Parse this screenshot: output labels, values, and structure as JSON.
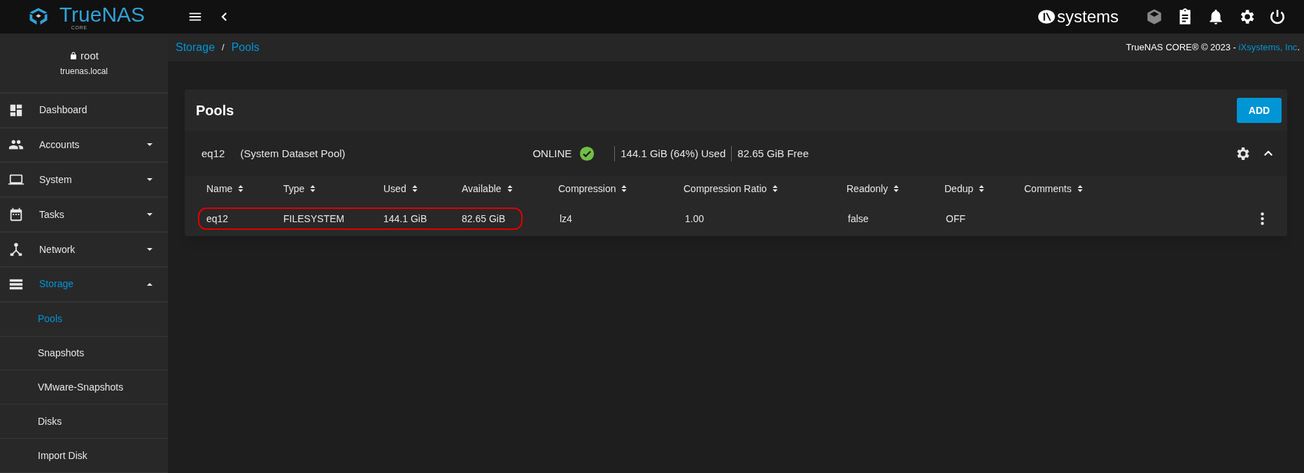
{
  "topbar": {
    "logo_text": "TrueNAS",
    "logo_sub": "CORE",
    "vendor_logo": "systems"
  },
  "user": {
    "name": "root",
    "host": "truenas.local"
  },
  "sidebar": {
    "items": [
      {
        "label": "Dashboard",
        "expandable": false,
        "expanded": false,
        "selected": false
      },
      {
        "label": "Accounts",
        "expandable": true,
        "expanded": false,
        "selected": false
      },
      {
        "label": "System",
        "expandable": true,
        "expanded": false,
        "selected": false
      },
      {
        "label": "Tasks",
        "expandable": true,
        "expanded": false,
        "selected": false
      },
      {
        "label": "Network",
        "expandable": true,
        "expanded": false,
        "selected": false
      },
      {
        "label": "Storage",
        "expandable": true,
        "expanded": true,
        "selected": true,
        "children": [
          {
            "label": "Pools",
            "selected": true
          },
          {
            "label": "Snapshots",
            "selected": false
          },
          {
            "label": "VMware-Snapshots",
            "selected": false
          },
          {
            "label": "Disks",
            "selected": false
          },
          {
            "label": "Import Disk",
            "selected": false
          }
        ]
      }
    ]
  },
  "breadcrumb": {
    "separator": "/",
    "items": [
      "Storage",
      "Pools"
    ]
  },
  "copyright": {
    "text": "TrueNAS CORE® © 2023 - ",
    "link": "iXsystems, Inc",
    "end": "."
  },
  "card": {
    "title": "Pools",
    "add_button": "ADD",
    "pool": {
      "name": "eq12",
      "note": "(System Dataset Pool)",
      "status": "ONLINE",
      "healthy": true,
      "used": "144.1 GiB (64%) Used",
      "free": "82.65 GiB Free",
      "expanded": true
    },
    "table": {
      "columns": [
        "Name",
        "Type",
        "Used",
        "Available",
        "Compression",
        "Compression Ratio",
        "Readonly",
        "Dedup",
        "Comments"
      ],
      "rows": [
        {
          "cells": [
            {
              "text": "eq12",
              "outlined": true
            },
            {
              "text": "FILESYSTEM",
              "outlined": true
            },
            {
              "text": "144.1 GiB",
              "outlined": true
            },
            {
              "text": "82.65 GiB",
              "outlined": true
            },
            {
              "text": "lz4",
              "outlined": false
            },
            {
              "text": "1.00",
              "outlined": false
            },
            {
              "text": "false",
              "outlined": false
            },
            {
              "text": "OFF",
              "outlined": false
            }
          ]
        }
      ]
    }
  }
}
